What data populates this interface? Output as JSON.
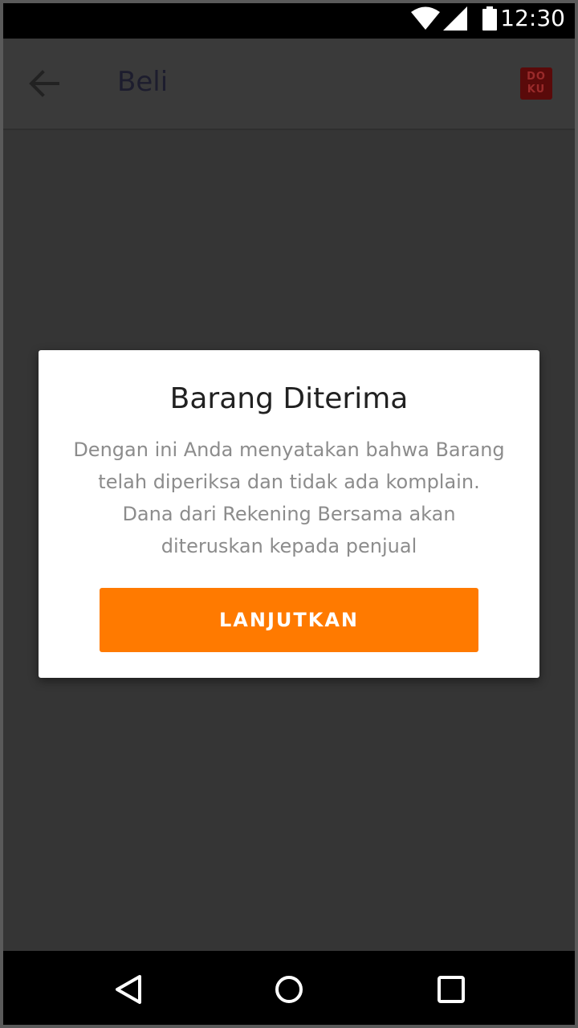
{
  "status_bar": {
    "time": "12:30",
    "icons": [
      "wifi-icon",
      "signal-icon",
      "battery-icon"
    ]
  },
  "app_bar": {
    "title": "Beli",
    "logo_text_top": "DO",
    "logo_text_bottom": "KU",
    "back_icon": "arrow-left-icon"
  },
  "dialog": {
    "title": "Barang Diterima",
    "message": "Dengan ini Anda menyatakan bahwa Barang telah diperiksa dan tidak ada komplain. Dana dari Rekening Bersama akan diteruskan kepada penjual",
    "button_label": "LANJUTKAN"
  },
  "nav_bar": {
    "icons": [
      "nav-back-icon",
      "nav-home-icon",
      "nav-recent-icon"
    ]
  },
  "colors": {
    "accent": "#ff7a00",
    "scrim": "#353535",
    "dialog_bg": "#ffffff"
  }
}
